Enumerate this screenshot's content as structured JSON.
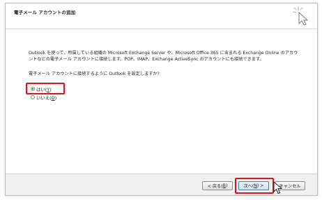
{
  "header": {
    "title": "電子メール アカウントの追加",
    "icon": "wizard-cursor-icon"
  },
  "content": {
    "description": "Outlook を使って、所属している組織の Microsoft Exchange Server や、Microsoft Office 365 に含まれる Exchange Online のアカウントなどの電子メール アカウントに接続します。POP、IMAP、Exchange ActiveSync のアカウントにも接続できます。",
    "question": "電子メール アカウントに接続するように Outlook を設定しますか?",
    "options": [
      {
        "label": "はい(",
        "accel": "Y",
        "suffix": ")",
        "checked": true
      },
      {
        "label": "いいえ(",
        "accel": "O",
        "suffix": ")",
        "checked": false
      }
    ]
  },
  "footer": {
    "back": {
      "label": "< 戻る(",
      "accel": "B",
      "suffix": ")"
    },
    "next": {
      "label": "次へ(",
      "accel": "N",
      "suffix": ") >"
    },
    "cancel": {
      "label": "キャンセル"
    }
  },
  "colors": {
    "highlight": "#e0121a",
    "dialog_border": "#bcbcbc",
    "footer_bg": "#f0f0f0"
  }
}
